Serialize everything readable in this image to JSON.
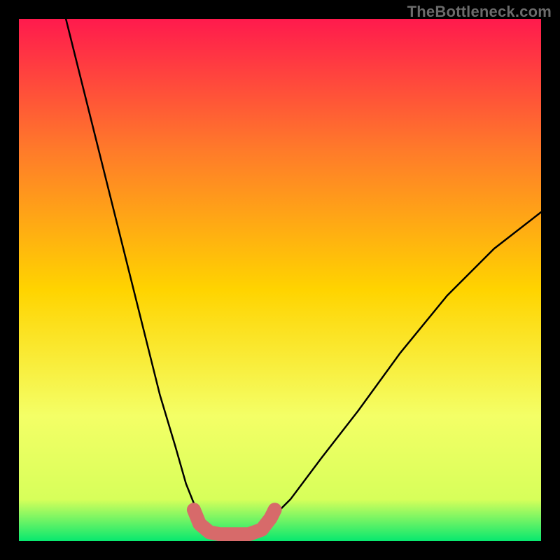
{
  "watermark": "TheBottleneck.com",
  "chart_data": {
    "type": "line",
    "title": "",
    "xlabel": "",
    "ylabel": "",
    "xlim": [
      0,
      100
    ],
    "ylim": [
      0,
      100
    ],
    "grid": false,
    "legend": false,
    "background_gradient": {
      "top": "#ff1a4d",
      "upper_mid": "#ff7a2a",
      "mid": "#ffd400",
      "lower_mid": "#f4ff66",
      "near_bottom": "#d7ff5a",
      "bottom": "#07e86f"
    },
    "series": [
      {
        "name": "left-branch",
        "stroke": "#000000",
        "points": [
          {
            "x": 9,
            "y": 100
          },
          {
            "x": 12,
            "y": 88
          },
          {
            "x": 16,
            "y": 72
          },
          {
            "x": 20,
            "y": 56
          },
          {
            "x": 24,
            "y": 40
          },
          {
            "x": 27,
            "y": 28
          },
          {
            "x": 30,
            "y": 18
          },
          {
            "x": 32,
            "y": 11
          },
          {
            "x": 34,
            "y": 6
          },
          {
            "x": 36,
            "y": 3
          },
          {
            "x": 38,
            "y": 1.3
          }
        ]
      },
      {
        "name": "right-branch",
        "stroke": "#000000",
        "points": [
          {
            "x": 44,
            "y": 1.3
          },
          {
            "x": 47,
            "y": 3
          },
          {
            "x": 52,
            "y": 8
          },
          {
            "x": 58,
            "y": 16
          },
          {
            "x": 65,
            "y": 25
          },
          {
            "x": 73,
            "y": 36
          },
          {
            "x": 82,
            "y": 47
          },
          {
            "x": 91,
            "y": 56
          },
          {
            "x": 100,
            "y": 63
          }
        ]
      },
      {
        "name": "bottom-shape",
        "stroke": "#d76a6a",
        "stroke_width_px": 20,
        "points": [
          {
            "x": 33.5,
            "y": 6.0
          },
          {
            "x": 34.6,
            "y": 3.3
          },
          {
            "x": 36.5,
            "y": 1.7
          },
          {
            "x": 38.5,
            "y": 1.3
          },
          {
            "x": 41.0,
            "y": 1.3
          },
          {
            "x": 44.0,
            "y": 1.3
          },
          {
            "x": 46.5,
            "y": 2.2
          },
          {
            "x": 48.2,
            "y": 4.4
          },
          {
            "x": 49.0,
            "y": 6.0
          }
        ]
      }
    ]
  }
}
